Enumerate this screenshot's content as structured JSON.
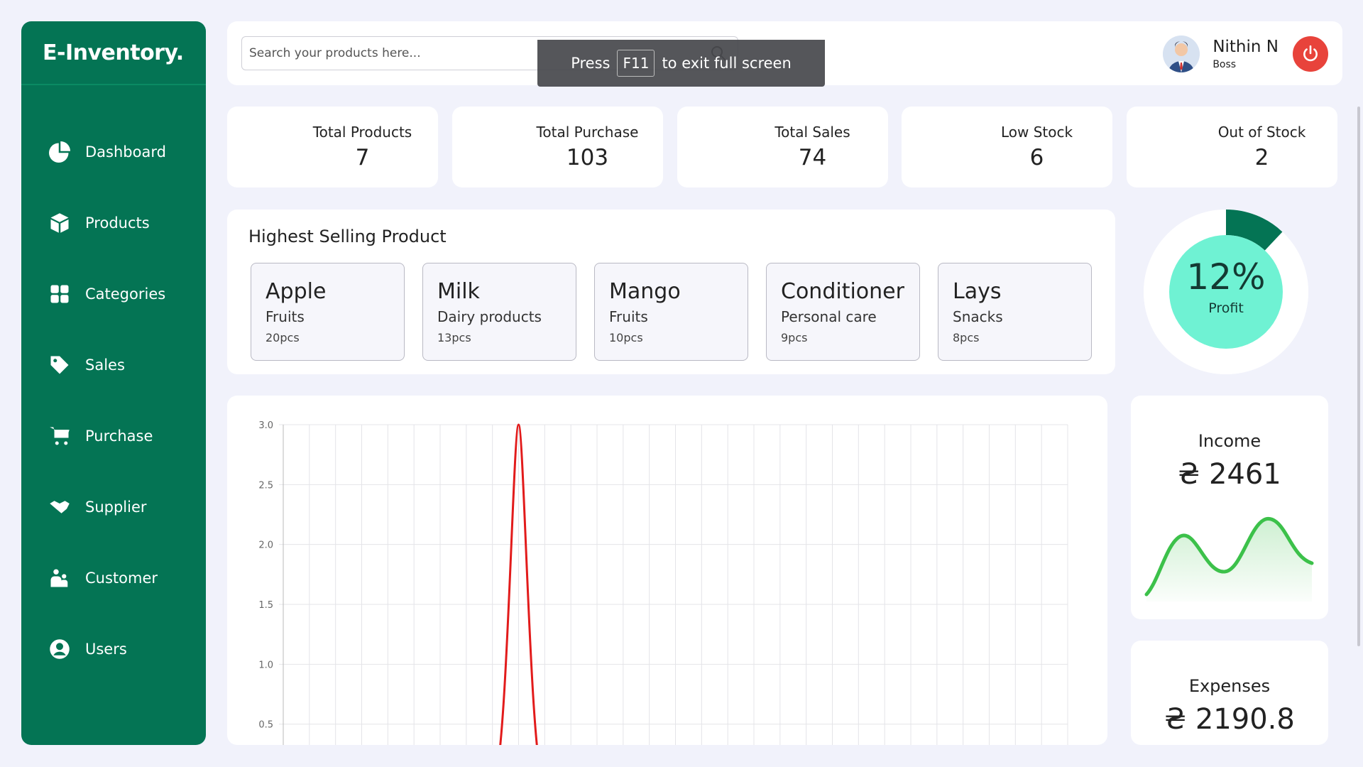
{
  "brand": "E-Inventory.",
  "colors": {
    "sidebar": "#047454",
    "accent": "#6ff2d3",
    "danger": "#e8433b",
    "chart_line": "#e21b1b",
    "income_line": "#3cc14a"
  },
  "sidebar": {
    "items": [
      {
        "label": "Dashboard",
        "icon": "pie-chart-icon"
      },
      {
        "label": "Products",
        "icon": "box-icon"
      },
      {
        "label": "Categories",
        "icon": "grid-icon"
      },
      {
        "label": "Sales",
        "icon": "tag-icon"
      },
      {
        "label": "Purchase",
        "icon": "cart-icon"
      },
      {
        "label": "Supplier",
        "icon": "handshake-icon"
      },
      {
        "label": "Customer",
        "icon": "people-icon"
      },
      {
        "label": "Users",
        "icon": "user-circle-icon"
      }
    ]
  },
  "header": {
    "search_placeholder": "Search your products here...",
    "toast": {
      "prefix": "Press",
      "key": "F11",
      "suffix": "to exit full screen"
    },
    "user": {
      "name": "Nithin N",
      "role": "Boss"
    }
  },
  "stats": [
    {
      "label": "Total Products",
      "value": "7"
    },
    {
      "label": "Total Purchase",
      "value": "103"
    },
    {
      "label": "Total Sales",
      "value": "74"
    },
    {
      "label": "Low Stock",
      "value": "6"
    },
    {
      "label": "Out of Stock",
      "value": "2"
    }
  ],
  "highest_selling": {
    "title": "Highest Selling Product",
    "products": [
      {
        "name": "Apple",
        "category": "Fruits",
        "qty": "20pcs"
      },
      {
        "name": "Milk",
        "category": "Dairy products",
        "qty": "13pcs"
      },
      {
        "name": "Mango",
        "category": "Fruits",
        "qty": "10pcs"
      },
      {
        "name": "Conditioner",
        "category": "Personal care",
        "qty": "9pcs"
      },
      {
        "name": "Lays",
        "category": "Snacks",
        "qty": "8pcs"
      }
    ]
  },
  "profit": {
    "value": "12%",
    "label": "Profit",
    "fraction": 0.12
  },
  "income": {
    "label": "Income",
    "value": "₴ 2461"
  },
  "expenses": {
    "label": "Expenses",
    "value": "₴ 2190.8"
  },
  "chart_data": {
    "type": "line",
    "ylim": [
      0,
      3.0
    ],
    "yticks": [
      "3.0",
      "2.5",
      "2.0",
      "1.5",
      "1.0",
      "0.5"
    ],
    "grid": true,
    "x_columns": 30,
    "series": [
      {
        "points": [
          [
            0,
            0
          ],
          [
            8,
            0
          ],
          [
            9,
            3.0
          ],
          [
            10,
            0
          ],
          [
            30,
            0
          ]
        ]
      }
    ]
  }
}
